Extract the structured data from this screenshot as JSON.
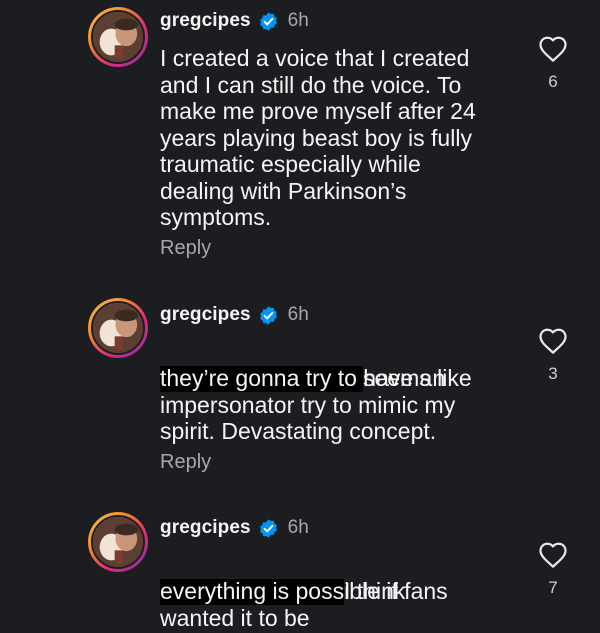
{
  "comments": [
    {
      "username": "gregcipes",
      "timestamp": "6h",
      "text": "I created a voice that I created\nand I can still do the voice. To\nmake me prove myself after 24\nyears playing beast boy is fully\ntraumatic especially while\ndealing with Parkinson’s\nsymptoms.",
      "redacted_prefix": false,
      "reply_label": "Reply",
      "likes": "6"
    },
    {
      "username": "gregcipes",
      "timestamp": "6h",
      "text_after_redaction": "seems like",
      "text": "they’re gonna try to have an\nimpersonator try to mimic my\nspirit. Devastating concept.",
      "redacted_prefix": true,
      "reply_label": "Reply",
      "likes": "3"
    },
    {
      "username": "gregcipes",
      "timestamp": "6h",
      "text_after_redaction": "I think",
      "text": "everything is possible if fans\nwanted it to be",
      "redacted_prefix": true,
      "reply_label": "",
      "likes": "7"
    }
  ],
  "icons": {
    "verified": "verified-badge-icon",
    "like": "heart-outline-icon"
  },
  "colors": {
    "background": "#1c1d20",
    "text": "#f5f5f5",
    "muted": "#a8a8a8",
    "verified": "#0095f6"
  }
}
